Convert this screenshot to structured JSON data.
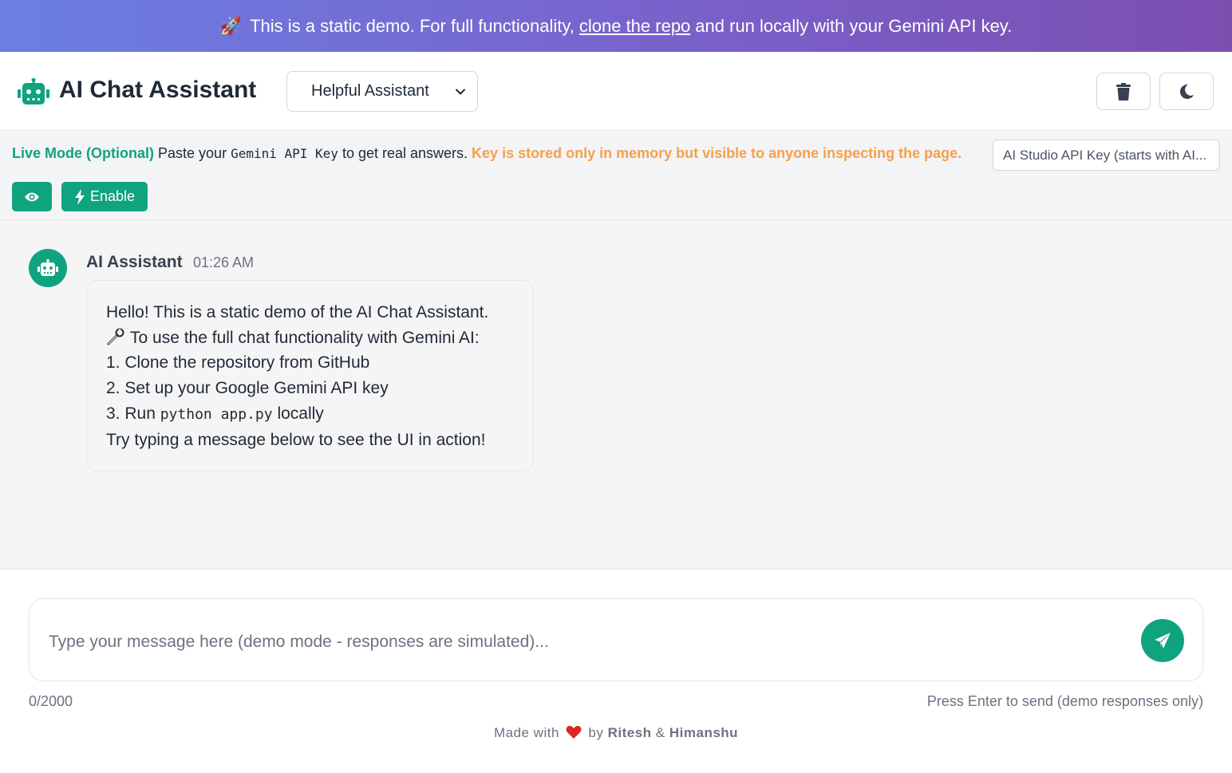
{
  "banner": {
    "icon": "rocket-icon",
    "text_before": "This is a static demo. For full functionality,",
    "link_text": "clone the repo",
    "text_after": "and run locally with your Gemini API key."
  },
  "header": {
    "app_title": "AI Chat Assistant",
    "persona_selected": "Helpful Assistant",
    "clear_icon": "trash-icon",
    "theme_icon": "moon-icon"
  },
  "live_mode": {
    "label": "Live Mode (Optional)",
    "text_1": "Paste your",
    "code": "Gemini API Key",
    "text_2": "to get real answers.",
    "warning": "Key is stored only in memory but visible to anyone inspecting the page.",
    "key_placeholder": "AI Studio API Key (starts with AI...",
    "enable_label": "Enable"
  },
  "chat": {
    "messages": [
      {
        "sender": "AI Assistant",
        "time": "01:26 AM",
        "line1": "Hello! This is a static demo of the AI Chat Assistant.",
        "line2_icon": "wrench-icon",
        "line2": "To use the full chat functionality with Gemini AI:",
        "line3": "1. Clone the repository from GitHub",
        "line4": "2. Set up your Google Gemini API key",
        "line5_pre": "3. Run",
        "line5_code": "python app.py",
        "line5_post": "locally",
        "line6": "Try typing a message below to see the UI in action!"
      }
    ]
  },
  "composer": {
    "placeholder": "Type your message here (demo mode - responses are simulated)...",
    "value": ""
  },
  "status": {
    "counter": "0/2000",
    "hint": "Press Enter to send (demo responses only)"
  },
  "footer": {
    "made_with": "Made with",
    "by": "by",
    "author1": "Ritesh",
    "amp": "&",
    "author2": "Himanshu"
  },
  "colors": {
    "accent": "#10a37f",
    "warning": "#f5a04a",
    "banner_start": "#6b7fe3",
    "banner_end": "#7b4fb0"
  }
}
